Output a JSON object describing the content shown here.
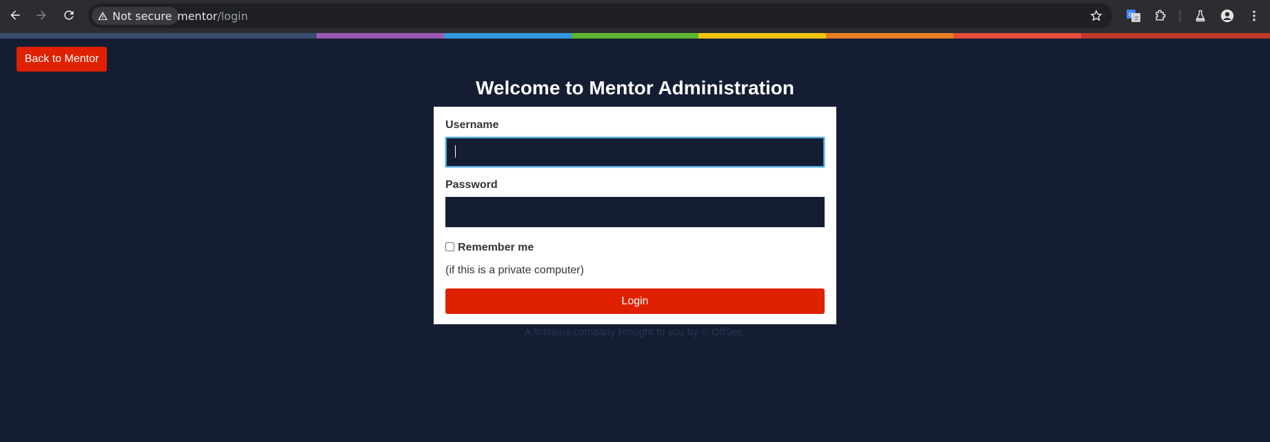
{
  "browser": {
    "security_label": "Not secure",
    "url_host": "mentor",
    "url_path": "/login"
  },
  "rainbow_colors": [
    "#3b4d6e",
    "#9b59b6",
    "#3498db",
    "#5cb531",
    "#f1c40f",
    "#e67e22",
    "#e74c3c",
    "#c0392b"
  ],
  "page": {
    "back_button": "Back to Mentor",
    "title": "Welcome to Mentor Administration",
    "form": {
      "username_label": "Username",
      "username_value": "",
      "password_label": "Password",
      "password_value": "",
      "remember_label": "Remember me",
      "remember_hint": "(if this is a private computer)",
      "login_button": "Login"
    },
    "footer": "A fictitious company brought to you by © OffSec."
  },
  "colors": {
    "accent": "#e02100",
    "background": "#151d33",
    "focus": "#4aa3e0"
  }
}
